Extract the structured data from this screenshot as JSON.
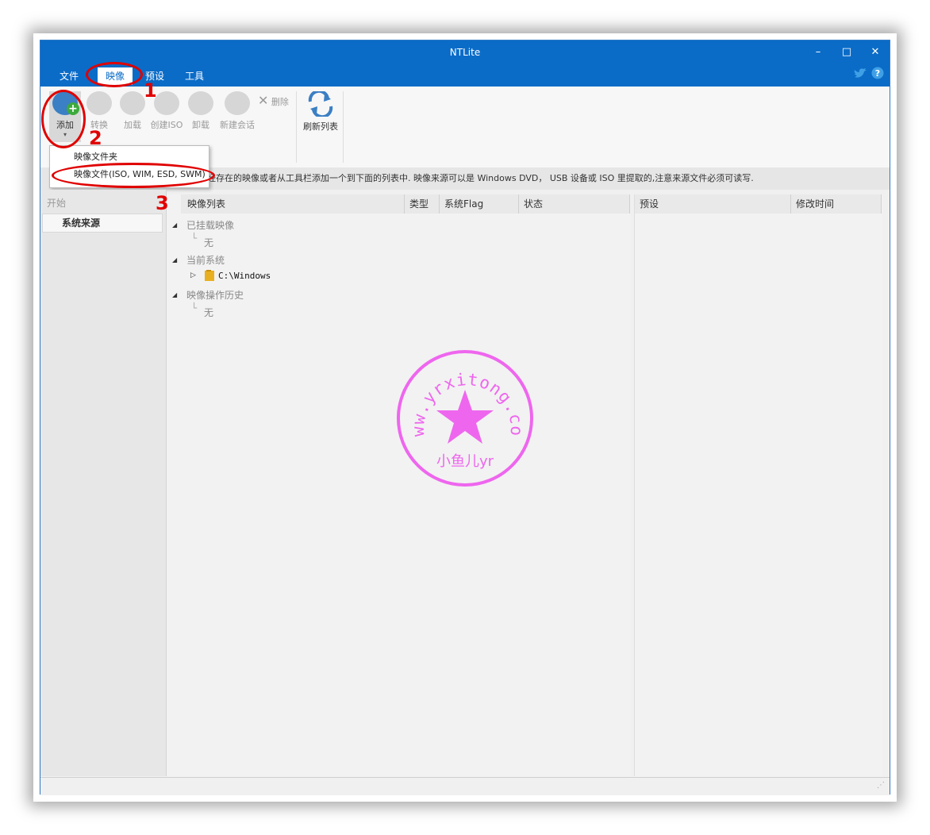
{
  "window": {
    "title": "NTLite",
    "minimize": "–",
    "maximize": "□",
    "close": "✕"
  },
  "menu": [
    {
      "label": "文件"
    },
    {
      "label": "映像"
    },
    {
      "label": "预设"
    },
    {
      "label": "工具"
    }
  ],
  "toolbar": {
    "add": "添加",
    "convert": "转换",
    "load": "加载",
    "create_iso": "创建ISO",
    "unload": "卸载",
    "new_session": "新建会话",
    "delete": "删除",
    "refresh": "刷新列表"
  },
  "dropdown": {
    "items": [
      {
        "label": "映像文件夹"
      },
      {
        "label": "映像文件(ISO, WIM, ESD, SWM)"
      }
    ]
  },
  "info_text": "经存在的映像或者从工具栏添加一个到下面的列表中. 映像来源可以是 Windows DVD， USB 设备或 ISO 里提取的,注意来源文件必须可读写.",
  "left": {
    "header": "开始",
    "item": "系统来源"
  },
  "columns": {
    "image_list": "映像列表",
    "type": "类型",
    "flag": "系统Flag",
    "state": "状态",
    "preset": "预设",
    "modified": "修改时间"
  },
  "tree": {
    "mounted": "已挂载映像",
    "mounted_none": "无",
    "current": "当前系统",
    "current_path": "C:\\Windows",
    "history": "映像操作历史",
    "history_none": "无"
  },
  "annotations": {
    "n1": "1",
    "n2": "2",
    "n3": "3"
  },
  "watermark": {
    "top": "www.yrxitong.com",
    "bottom": "小鱼儿yr"
  },
  "colors": {
    "titlebar": "#0b6cc8",
    "annotation": "#e00000",
    "watermark": "#ee66ee"
  }
}
